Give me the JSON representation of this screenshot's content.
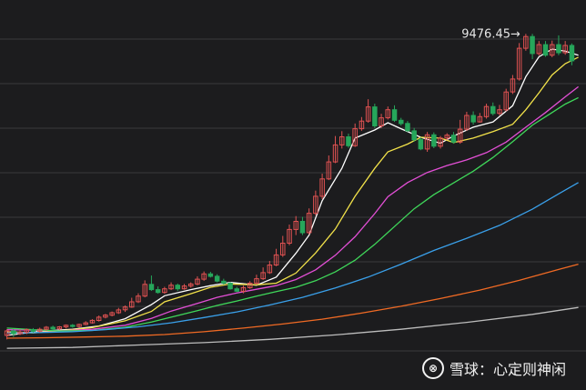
{
  "chart_data": {
    "type": "candlestick",
    "peak_label": "9476.45→",
    "ylim": [
      1500,
      10000
    ],
    "grid": "horizontal",
    "colors": {
      "background": "#1c1c1e",
      "grid": "#3a3a3c",
      "up": "#e05252",
      "down": "#26a65b",
      "ma_white": "#ffffff",
      "ma_yellow": "#f2e24a",
      "ma_magenta": "#e34fd6",
      "ma_green": "#3fd85a",
      "ma_blue": "#3aa0ea",
      "ma_orange": "#f06a24",
      "ma_gray": "#bdbdbd"
    },
    "candles": [
      [
        2020,
        2130,
        1920,
        2170
      ],
      [
        2130,
        2060,
        1980,
        2170
      ],
      [
        2060,
        2100,
        2030,
        2160
      ],
      [
        2100,
        2160,
        2050,
        2190
      ],
      [
        2160,
        2120,
        2090,
        2200
      ],
      [
        2120,
        2170,
        2090,
        2210
      ],
      [
        2170,
        2220,
        2130,
        2250
      ],
      [
        2220,
        2180,
        2150,
        2260
      ],
      [
        2180,
        2230,
        2150,
        2250
      ],
      [
        2230,
        2270,
        2190,
        2290
      ],
      [
        2270,
        2240,
        2210,
        2300
      ],
      [
        2240,
        2290,
        2210,
        2310
      ],
      [
        2290,
        2330,
        2270,
        2370
      ],
      [
        2330,
        2390,
        2310,
        2420
      ],
      [
        2390,
        2470,
        2360,
        2510
      ],
      [
        2470,
        2520,
        2440,
        2550
      ],
      [
        2520,
        2580,
        2490,
        2610
      ],
      [
        2580,
        2650,
        2550,
        2700
      ],
      [
        2650,
        2720,
        2600,
        2760
      ],
      [
        2720,
        2850,
        2700,
        2950
      ],
      [
        2850,
        2990,
        2820,
        3060
      ],
      [
        2990,
        3280,
        2960,
        3380
      ],
      [
        3280,
        3150,
        3120,
        3500
      ],
      [
        3150,
        3080,
        3050,
        3230
      ],
      [
        3080,
        3170,
        3050,
        3220
      ],
      [
        3170,
        3260,
        3140,
        3330
      ],
      [
        3260,
        3170,
        3120,
        3300
      ],
      [
        3170,
        3240,
        3150,
        3290
      ],
      [
        3240,
        3290,
        3200,
        3330
      ],
      [
        3290,
        3410,
        3260,
        3480
      ],
      [
        3410,
        3540,
        3370,
        3600
      ],
      [
        3540,
        3480,
        3450,
        3590
      ],
      [
        3480,
        3360,
        3330,
        3530
      ],
      [
        3360,
        3310,
        3270,
        3420
      ],
      [
        3310,
        3170,
        3150,
        3340
      ],
      [
        3170,
        3110,
        3090,
        3220
      ],
      [
        3110,
        3200,
        3060,
        3250
      ],
      [
        3200,
        3310,
        3170,
        3360
      ],
      [
        3310,
        3420,
        3280,
        3520
      ],
      [
        3420,
        3570,
        3390,
        3700
      ],
      [
        3570,
        3760,
        3540,
        3860
      ],
      [
        3760,
        4010,
        3730,
        4160
      ],
      [
        4010,
        4300,
        3960,
        4480
      ],
      [
        4300,
        4640,
        4250,
        4760
      ],
      [
        4640,
        4840,
        4500,
        4970
      ],
      [
        4840,
        4560,
        4500,
        4950
      ],
      [
        4560,
        5040,
        4520,
        5160
      ],
      [
        5040,
        5460,
        4990,
        5600
      ],
      [
        5460,
        5890,
        5390,
        6020
      ],
      [
        5890,
        6310,
        5860,
        6470
      ],
      [
        6310,
        6730,
        6280,
        6950
      ],
      [
        6730,
        6930,
        6640,
        7070
      ],
      [
        6930,
        6710,
        6660,
        7010
      ],
      [
        6710,
        7130,
        6680,
        7260
      ],
      [
        7130,
        7320,
        7080,
        7420
      ],
      [
        7320,
        7670,
        7280,
        7860
      ],
      [
        7670,
        7200,
        7150,
        7750
      ],
      [
        7200,
        7400,
        7150,
        7500
      ],
      [
        7400,
        7600,
        7360,
        7680
      ],
      [
        7600,
        7340,
        7300,
        7710
      ],
      [
        7340,
        7260,
        7210,
        7400
      ],
      [
        7260,
        7080,
        7050,
        7320
      ],
      [
        7080,
        6860,
        6810,
        7150
      ],
      [
        6860,
        6630,
        6600,
        6920
      ],
      [
        6630,
        6980,
        6560,
        7050
      ],
      [
        6980,
        6700,
        6650,
        7040
      ],
      [
        6700,
        6900,
        6640,
        6950
      ],
      [
        6900,
        6970,
        6850,
        7020
      ],
      [
        6970,
        6800,
        6760,
        7050
      ],
      [
        6800,
        7120,
        6760,
        7350
      ],
      [
        7120,
        7460,
        7080,
        7550
      ],
      [
        7460,
        7300,
        7230,
        7560
      ],
      [
        7300,
        7430,
        7280,
        7520
      ],
      [
        7430,
        7680,
        7380,
        7750
      ],
      [
        7680,
        7510,
        7460,
        7780
      ],
      [
        7510,
        7600,
        7460,
        7720
      ],
      [
        7600,
        8040,
        7560,
        8120
      ],
      [
        8040,
        8360,
        7990,
        8460
      ],
      [
        8360,
        9120,
        8320,
        9250
      ],
      [
        9120,
        9410,
        9060,
        9476.45
      ],
      [
        9410,
        8990,
        8850,
        9476
      ],
      [
        8990,
        9210,
        8940,
        9300
      ],
      [
        9210,
        8950,
        8910,
        9300
      ],
      [
        8950,
        9210,
        8900,
        9310
      ],
      [
        9210,
        9010,
        8950,
        9440
      ],
      [
        9010,
        9190,
        8960,
        9300
      ],
      [
        9190,
        8810,
        8700,
        9240
      ]
    ],
    "ma_series": [
      {
        "color_key": "ma_white",
        "points": [
          [
            0,
            2020
          ],
          [
            5,
            2120
          ],
          [
            10,
            2170
          ],
          [
            14,
            2250
          ],
          [
            18,
            2430
          ],
          [
            22,
            2780
          ],
          [
            24,
            3000
          ],
          [
            28,
            3150
          ],
          [
            31,
            3250
          ],
          [
            34,
            3330
          ],
          [
            38,
            3260
          ],
          [
            41,
            3460
          ],
          [
            44,
            4050
          ],
          [
            46,
            4500
          ],
          [
            48,
            5350
          ],
          [
            51,
            6150
          ],
          [
            53,
            6900
          ],
          [
            56,
            7100
          ],
          [
            58,
            7280
          ],
          [
            60,
            7130
          ],
          [
            63,
            6920
          ],
          [
            66,
            6770
          ],
          [
            68,
            6950
          ],
          [
            71,
            7170
          ],
          [
            74,
            7300
          ],
          [
            77,
            7700
          ],
          [
            79,
            8420
          ],
          [
            81,
            8910
          ],
          [
            83,
            9100
          ],
          [
            85,
            9050
          ],
          [
            87,
            8950
          ]
        ]
      },
      {
        "color_key": "ma_yellow",
        "points": [
          [
            0,
            2110
          ],
          [
            4,
            2080
          ],
          [
            8,
            2130
          ],
          [
            13,
            2210
          ],
          [
            18,
            2380
          ],
          [
            22,
            2610
          ],
          [
            24,
            2850
          ],
          [
            28,
            3050
          ],
          [
            31,
            3210
          ],
          [
            34,
            3290
          ],
          [
            38,
            3270
          ],
          [
            41,
            3310
          ],
          [
            44,
            3560
          ],
          [
            47,
            4060
          ],
          [
            50,
            4650
          ],
          [
            53,
            5460
          ],
          [
            56,
            6150
          ],
          [
            58,
            6560
          ],
          [
            61,
            6750
          ],
          [
            63,
            6920
          ],
          [
            66,
            6900
          ],
          [
            68,
            6790
          ],
          [
            71,
            6900
          ],
          [
            74,
            7060
          ],
          [
            77,
            7240
          ],
          [
            79,
            7600
          ],
          [
            81,
            8020
          ],
          [
            83,
            8460
          ],
          [
            85,
            8740
          ],
          [
            87,
            8900
          ]
        ]
      },
      {
        "color_key": "ma_magenta",
        "points": [
          [
            0,
            2160
          ],
          [
            4,
            2150
          ],
          [
            8,
            2130
          ],
          [
            13,
            2170
          ],
          [
            18,
            2270
          ],
          [
            22,
            2440
          ],
          [
            25,
            2620
          ],
          [
            29,
            2810
          ],
          [
            32,
            2960
          ],
          [
            35,
            3070
          ],
          [
            38,
            3160
          ],
          [
            41,
            3250
          ],
          [
            44,
            3400
          ],
          [
            47,
            3640
          ],
          [
            50,
            4000
          ],
          [
            53,
            4460
          ],
          [
            56,
            5030
          ],
          [
            58,
            5450
          ],
          [
            61,
            5800
          ],
          [
            64,
            6050
          ],
          [
            67,
            6220
          ],
          [
            70,
            6360
          ],
          [
            73,
            6540
          ],
          [
            76,
            6800
          ],
          [
            79,
            7170
          ],
          [
            82,
            7530
          ],
          [
            85,
            7920
          ],
          [
            87,
            8170
          ]
        ]
      },
      {
        "color_key": "ma_green",
        "points": [
          [
            0,
            2200
          ],
          [
            4,
            2160
          ],
          [
            8,
            2130
          ],
          [
            13,
            2140
          ],
          [
            18,
            2220
          ],
          [
            22,
            2350
          ],
          [
            25,
            2470
          ],
          [
            29,
            2630
          ],
          [
            32,
            2760
          ],
          [
            35,
            2870
          ],
          [
            38,
            2990
          ],
          [
            41,
            3100
          ],
          [
            44,
            3210
          ],
          [
            47,
            3370
          ],
          [
            50,
            3590
          ],
          [
            53,
            3880
          ],
          [
            56,
            4270
          ],
          [
            59,
            4710
          ],
          [
            62,
            5150
          ],
          [
            65,
            5500
          ],
          [
            68,
            5790
          ],
          [
            71,
            6080
          ],
          [
            74,
            6420
          ],
          [
            77,
            6810
          ],
          [
            80,
            7220
          ],
          [
            83,
            7530
          ],
          [
            85,
            7740
          ],
          [
            87,
            7900
          ]
        ]
      },
      {
        "color_key": "ma_blue",
        "points": [
          [
            0,
            2080
          ],
          [
            5,
            2090
          ],
          [
            10,
            2110
          ],
          [
            15,
            2160
          ],
          [
            20,
            2230
          ],
          [
            25,
            2330
          ],
          [
            30,
            2460
          ],
          [
            35,
            2600
          ],
          [
            40,
            2770
          ],
          [
            45,
            2960
          ],
          [
            50,
            3190
          ],
          [
            55,
            3460
          ],
          [
            60,
            3780
          ],
          [
            65,
            4120
          ],
          [
            70,
            4420
          ],
          [
            75,
            4740
          ],
          [
            80,
            5140
          ],
          [
            84,
            5520
          ],
          [
            87,
            5800
          ]
        ]
      },
      {
        "color_key": "ma_orange",
        "points": [
          [
            0,
            1950
          ],
          [
            6,
            1960
          ],
          [
            12,
            1980
          ],
          [
            18,
            2000
          ],
          [
            24,
            2040
          ],
          [
            30,
            2110
          ],
          [
            36,
            2200
          ],
          [
            42,
            2300
          ],
          [
            48,
            2420
          ],
          [
            54,
            2570
          ],
          [
            60,
            2740
          ],
          [
            66,
            2930
          ],
          [
            72,
            3140
          ],
          [
            78,
            3380
          ],
          [
            84,
            3650
          ],
          [
            87,
            3780
          ]
        ]
      },
      {
        "color_key": "ma_gray",
        "points": [
          [
            0,
            1700
          ],
          [
            10,
            1720
          ],
          [
            20,
            1780
          ],
          [
            30,
            1840
          ],
          [
            40,
            1920
          ],
          [
            50,
            2030
          ],
          [
            60,
            2170
          ],
          [
            70,
            2340
          ],
          [
            80,
            2540
          ],
          [
            87,
            2710
          ]
        ]
      }
    ]
  },
  "watermark": {
    "logo_glyph": "⊗",
    "text": "雪球：心定则神闲"
  }
}
